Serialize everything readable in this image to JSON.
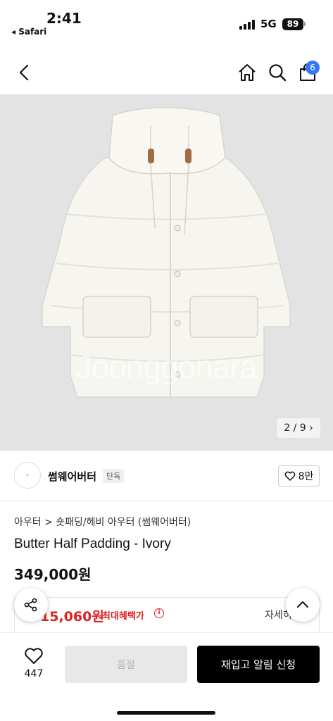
{
  "status_bar": {
    "time": "2:41",
    "back_app": "◂ Safari",
    "network": "5G",
    "battery": "89"
  },
  "nav": {
    "cart_count": "6",
    "icons": [
      "back-chevron-icon",
      "home-icon",
      "search-icon",
      "cart-bag-icon"
    ]
  },
  "gallery": {
    "watermark": "Joonggonara",
    "pager": "2 / 9 ›"
  },
  "brand": {
    "name": "썸웨어버터",
    "tag": "단독",
    "like_count": "8만"
  },
  "product": {
    "breadcrumb": "아우터 > 숏패딩/헤비 아우터 (썸웨어버터)",
    "title": "Butter Half Padding - Ivory",
    "price": "349,000원"
  },
  "benefit": {
    "max_price": "15,060원",
    "label": "최대혜택가",
    "info": "i",
    "detail": "자세히"
  },
  "bottom_bar": {
    "like_count": "447",
    "soldout_label": "품절",
    "restock_label": "재입고 알림 신청"
  },
  "colors": {
    "accent_red": "#e02020",
    "badge_blue": "#3478f6",
    "primary_button": "#000000"
  }
}
